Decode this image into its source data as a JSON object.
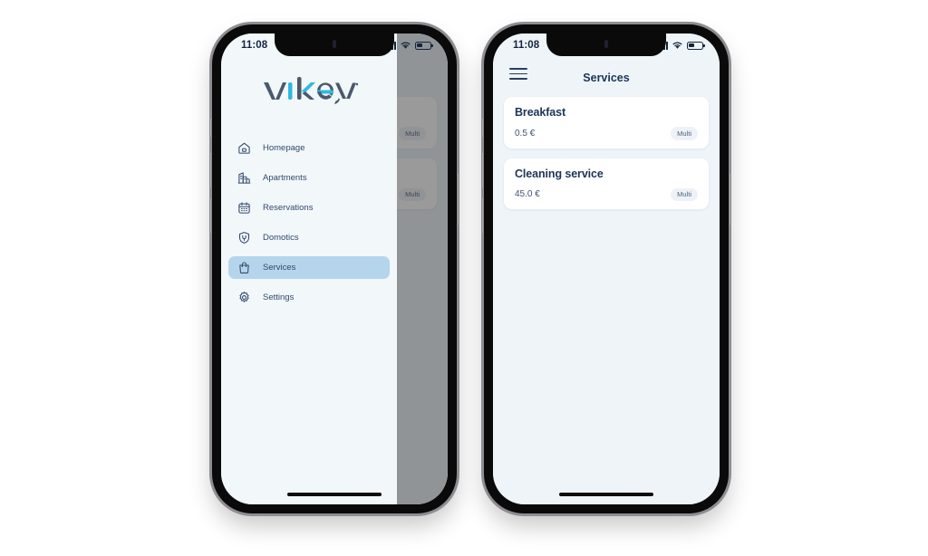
{
  "page": {
    "background": "#ffffff",
    "accent_highlight": "#b5d5ec",
    "card_background": "#ffffff",
    "app_background": "#eef4f8",
    "title_color": "#1c3557"
  },
  "status_bar": {
    "time": "11:08",
    "signal_icon": "cellular-signal-icon",
    "wifi_icon": "wifi-icon",
    "battery_icon": "battery-icon"
  },
  "phone_left": {
    "name": "phone-with-drawer-open",
    "drawer": {
      "logo_text": "vikey",
      "logo_colors": {
        "dark": "#4a5a6a",
        "accent": "#2fb8e0"
      },
      "items": [
        {
          "id": "homepage",
          "label": "Homepage",
          "icon": "home-icon",
          "active": false
        },
        {
          "id": "apartments",
          "label": "Apartments",
          "icon": "buildings-icon",
          "active": false
        },
        {
          "id": "reservations",
          "label": "Reservations",
          "icon": "calendar-icon",
          "active": false
        },
        {
          "id": "domotics",
          "label": "Domotics",
          "icon": "smart-plug-icon",
          "active": false
        },
        {
          "id": "services",
          "label": "Services",
          "icon": "shopping-bag-icon",
          "active": true
        },
        {
          "id": "settings",
          "label": "Settings",
          "icon": "gear-icon",
          "active": false
        }
      ]
    }
  },
  "phone_right": {
    "name": "phone-services-screen"
  },
  "services_screen": {
    "menu_icon": "hamburger-menu-icon",
    "title": "Services",
    "cards": [
      {
        "title": "Breakfast",
        "price": "0.5 €",
        "badge": "Multi"
      },
      {
        "title": "Cleaning service",
        "price": "45.0 €",
        "badge": "Multi"
      }
    ]
  }
}
